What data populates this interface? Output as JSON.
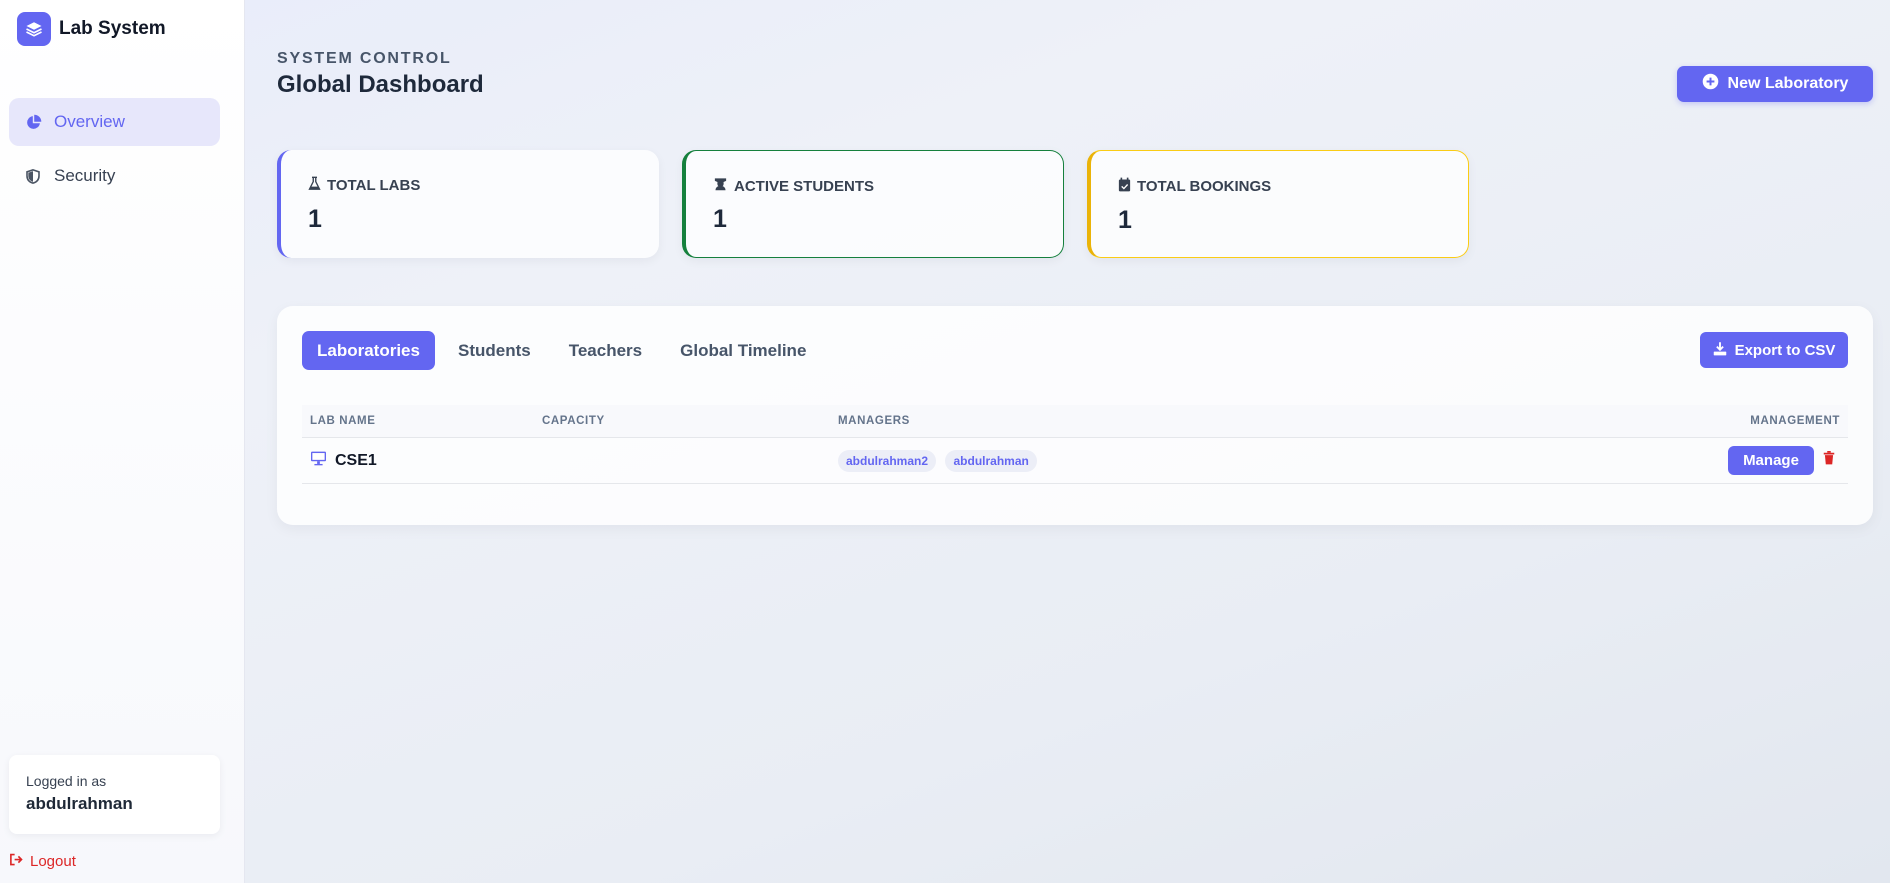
{
  "sidebar": {
    "brand": "Lab System",
    "items": [
      {
        "label": "Overview",
        "icon": "pie-chart-icon",
        "active": true
      },
      {
        "label": "Security",
        "icon": "shield-icon",
        "active": false
      }
    ],
    "user": {
      "label": "Logged in as",
      "name": "abdulrahman"
    },
    "logout": "Logout"
  },
  "header": {
    "eyebrow": "SYSTEM CONTROL",
    "title": "Global Dashboard",
    "new_lab_label": "New Laboratory"
  },
  "stats": [
    {
      "label": "TOTAL LABS",
      "value": "1",
      "icon": "flask-icon",
      "color": "#6366f1"
    },
    {
      "label": "ACTIVE STUDENTS",
      "value": "1",
      "icon": "graduate-icon",
      "color": "#15803d"
    },
    {
      "label": "TOTAL BOOKINGS",
      "value": "1",
      "icon": "calendar-icon",
      "color": "#eab308"
    }
  ],
  "main": {
    "tabs": [
      {
        "label": "Laboratories",
        "active": true
      },
      {
        "label": "Students",
        "active": false
      },
      {
        "label": "Teachers",
        "active": false
      },
      {
        "label": "Global Timeline",
        "active": false
      }
    ],
    "export_label": "Export to CSV",
    "table": {
      "columns": [
        "LAB NAME",
        "CAPACITY",
        "MANAGERS",
        "MANAGEMENT"
      ],
      "rows": [
        {
          "name": "CSE1",
          "capacity": "",
          "managers": [
            "abdulrahman2",
            "abdulrahman"
          ],
          "action": "Manage"
        }
      ]
    }
  },
  "colors": {
    "accent": "#6366f1",
    "danger": "#dc2626"
  }
}
